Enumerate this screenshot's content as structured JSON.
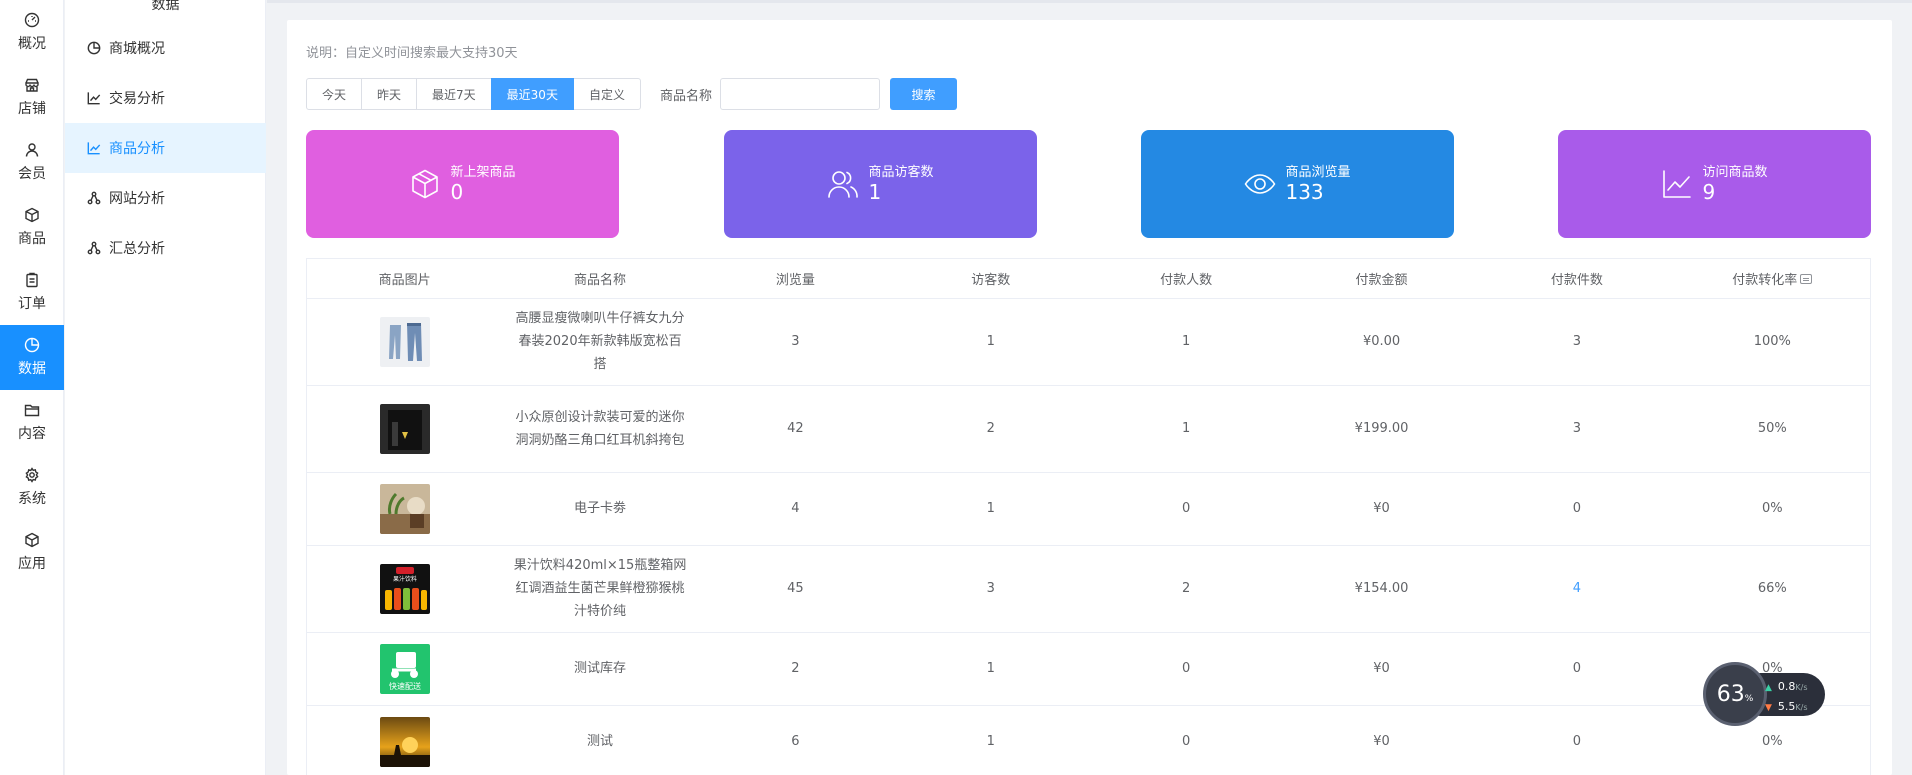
{
  "rail": {
    "items": [
      {
        "label": "概况",
        "icon": "gauge-icon"
      },
      {
        "label": "店铺",
        "icon": "store-icon"
      },
      {
        "label": "会员",
        "icon": "user-icon"
      },
      {
        "label": "商品",
        "icon": "box-icon"
      },
      {
        "label": "订单",
        "icon": "clipboard-icon"
      },
      {
        "label": "数据",
        "icon": "pie-icon",
        "active": true
      },
      {
        "label": "内容",
        "icon": "folder-icon"
      },
      {
        "label": "系统",
        "icon": "gear-icon"
      },
      {
        "label": "应用",
        "icon": "cube-icon"
      }
    ]
  },
  "submenu": {
    "title": "数据",
    "items": [
      {
        "label": "商城概况",
        "icon": "pie-icon"
      },
      {
        "label": "交易分析",
        "icon": "line-chart-icon"
      },
      {
        "label": "商品分析",
        "icon": "line-chart-icon",
        "active": true
      },
      {
        "label": "网站分析",
        "icon": "network-icon"
      },
      {
        "label": "汇总分析",
        "icon": "network-icon"
      }
    ]
  },
  "note": "说明：自定义时间搜索最大支持30天",
  "toolbar": {
    "ranges": [
      "今天",
      "昨天",
      "最近7天",
      "最近30天",
      "自定义"
    ],
    "active_range": "最近30天",
    "name_label": "商品名称",
    "name_value": "",
    "name_placeholder": "",
    "search_label": "搜索"
  },
  "stats": [
    {
      "label": "新上架商品",
      "value": "0",
      "color": "#e05fe0",
      "icon": "cube-icon"
    },
    {
      "label": "商品访客数",
      "value": "1",
      "color": "#7b63ea",
      "icon": "users-icon"
    },
    {
      "label": "商品浏览量",
      "value": "133",
      "color": "#2489e3",
      "icon": "eye-icon"
    },
    {
      "label": "访问商品数",
      "value": "9",
      "color": "#a95bea",
      "icon": "line-chart-icon"
    }
  ],
  "table": {
    "headers": [
      "商品图片",
      "商品名称",
      "浏览量",
      "访客数",
      "付款人数",
      "付款金额",
      "付款件数",
      "付款转化率"
    ],
    "rows": [
      {
        "name": "高腰显瘦微喇叭牛仔裤女九分春装2020年新款韩版宽松百搭",
        "views": "3",
        "visitors": "1",
        "payers": "1",
        "amount": "¥0.00",
        "qty": "3",
        "rate": "100%",
        "thumb": "jeans"
      },
      {
        "name": "小众原创设计款装可爱的迷你洞洞奶酪三角口红耳机斜挎包",
        "views": "42",
        "visitors": "2",
        "payers": "1",
        "amount": "¥199.00",
        "qty": "3",
        "rate": "50%",
        "thumb": "bag"
      },
      {
        "name": "电子卡劵",
        "views": "4",
        "visitors": "1",
        "payers": "0",
        "amount": "¥0",
        "qty": "0",
        "rate": "0%",
        "thumb": "plant"
      },
      {
        "name": "果汁饮料420ml×15瓶整箱网红调酒益生菌芒果鲜橙猕猴桃汁特价纯",
        "views": "45",
        "visitors": "3",
        "payers": "2",
        "amount": "¥154.00",
        "qty": "4",
        "rate": "66%",
        "thumb": "juice"
      },
      {
        "name": "测试库存",
        "views": "2",
        "visitors": "1",
        "payers": "0",
        "amount": "¥0",
        "qty": "0",
        "rate": "0%",
        "thumb": "delivery"
      },
      {
        "name": "测试",
        "views": "6",
        "visitors": "1",
        "payers": "0",
        "amount": "¥0",
        "qty": "0",
        "rate": "0%",
        "thumb": "sunset"
      }
    ]
  },
  "thumb_labels": {
    "juice": "果汁饮料",
    "delivery": "快速配送"
  },
  "speed_widget": {
    "percent": "63",
    "percent_unit": "%",
    "up": "0.8",
    "down": "5.5",
    "unit": "K/s"
  }
}
